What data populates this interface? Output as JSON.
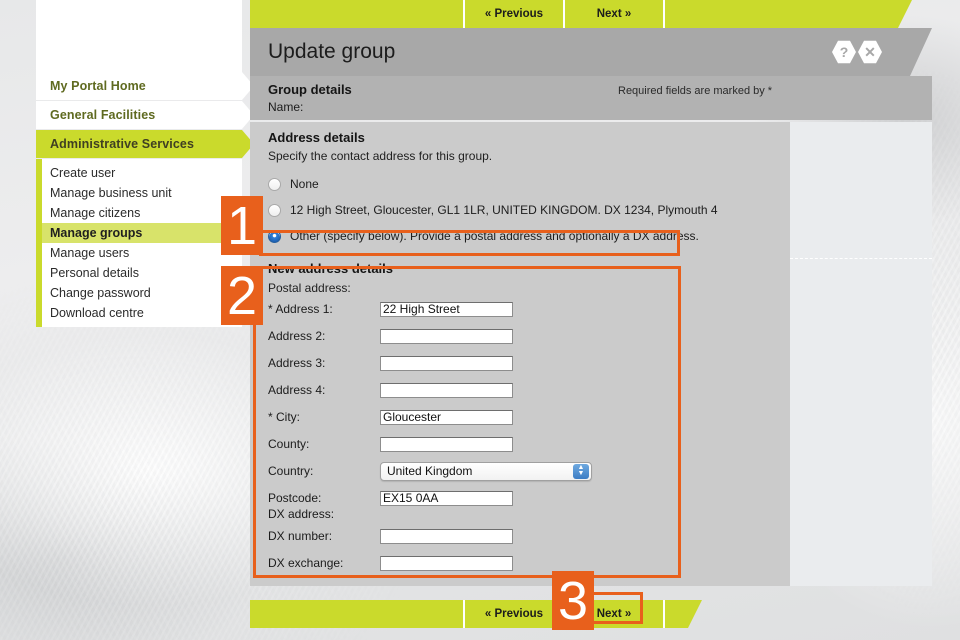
{
  "window": {
    "title": "Update group"
  },
  "wizard_top": {
    "previous_label": "« Previous",
    "next_label": "Next »"
  },
  "wizard_bottom": {
    "previous_label": "« Previous",
    "next_label": "Next »"
  },
  "title_bar": {
    "title": "Update group",
    "help_icon": "help-hexagon-icon",
    "help_glyph": "?",
    "close_icon": "close-hexagon-icon",
    "close_glyph": "✕"
  },
  "sidebar": {
    "top_items": [
      {
        "label": "My Portal Home",
        "active": false
      },
      {
        "label": "General Facilities",
        "active": false
      },
      {
        "label": "Administrative Services",
        "active": true
      }
    ],
    "sub_items": [
      {
        "label": "Create user",
        "current": false
      },
      {
        "label": "Manage business unit",
        "current": false
      },
      {
        "label": "Manage citizens",
        "current": false
      },
      {
        "label": "Manage groups",
        "current": true
      },
      {
        "label": "Manage users",
        "current": false
      },
      {
        "label": "Personal details",
        "current": false
      },
      {
        "label": "Change password",
        "current": false
      },
      {
        "label": "Download centre",
        "current": false
      }
    ]
  },
  "group_details": {
    "heading": "Group details",
    "name_label": "Name:",
    "name_value": "",
    "required_note": "Required fields are marked by *"
  },
  "address_details": {
    "heading": "Address details",
    "instruction": "Specify the contact address for this group.",
    "options": [
      {
        "label": "None",
        "selected": false
      },
      {
        "label": "12 High Street, Gloucester, GL1 1LR, UNITED KINGDOM. DX 1234, Plymouth 4",
        "selected": false
      },
      {
        "label": "Other (specify below). Provide a postal address and optionally a DX address.",
        "selected": true
      }
    ]
  },
  "new_address_details": {
    "heading": "New address details",
    "postal_label": "Postal address:",
    "fields": [
      {
        "label": "* Address 1:",
        "value": "22 High Street"
      },
      {
        "label": "Address 2:",
        "value": ""
      },
      {
        "label": "Address 3:",
        "value": ""
      },
      {
        "label": "Address 4:",
        "value": ""
      },
      {
        "label": "* City:",
        "value": "Gloucester"
      },
      {
        "label": "County:",
        "value": ""
      }
    ],
    "country": {
      "label": "Country:",
      "value": "United Kingdom"
    },
    "postcode": {
      "label": "Postcode:",
      "value": "EX15 0AA"
    },
    "dx_label": "DX address:",
    "dx_fields": [
      {
        "label": "DX number:",
        "value": ""
      },
      {
        "label": "DX exchange:",
        "value": ""
      }
    ]
  },
  "annotations": {
    "markers": [
      {
        "number": "1"
      },
      {
        "number": "2"
      },
      {
        "number": "3"
      }
    ],
    "accent_color": "#e8601c"
  },
  "colors": {
    "brand_green": "#cada2c",
    "title_gray": "#a8a8a8",
    "panel_gray": "#cbcbcb",
    "form_bg": "#eaecee",
    "annotation_orange": "#e8601c",
    "radio_blue": "#2f7fd8"
  }
}
